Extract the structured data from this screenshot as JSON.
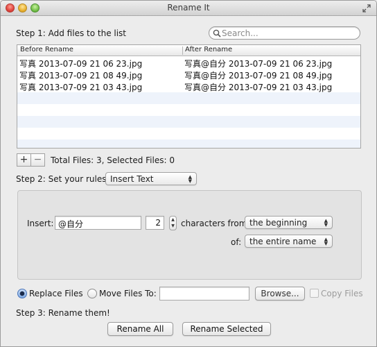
{
  "window": {
    "title": "Rename It"
  },
  "step1": {
    "label": "Step 1: Add files to the list"
  },
  "search": {
    "placeholder": "Search..."
  },
  "table": {
    "columns": [
      "Before Rename",
      "After Rename"
    ],
    "rows": [
      {
        "before": "写真 2013-07-09 21 06 23.jpg",
        "after": "写真@自分 2013-07-09 21 06 23.jpg"
      },
      {
        "before": "写真 2013-07-09 21 08 49.jpg",
        "after": "写真@自分 2013-07-09 21 08 49.jpg"
      },
      {
        "before": "写真 2013-07-09 21 03 43.jpg",
        "after": "写真@自分 2013-07-09 21 03 43.jpg"
      }
    ]
  },
  "list_controls": {
    "add_label": "+",
    "remove_label": "−",
    "status": "Total Files: 3,  Selected Files: 0"
  },
  "step2": {
    "label": "Step 2: Set your rules:",
    "rule_type": "Insert Text"
  },
  "rule": {
    "insert_label": "Insert:",
    "insert_value": "@自分",
    "count_value": "2",
    "characters_from_label": "characters from",
    "position_value": "the beginning",
    "of_label": "of:",
    "scope_value": "the entire name"
  },
  "output": {
    "replace_label": "Replace Files",
    "replace_selected": true,
    "move_label": "Move Files To:",
    "move_path": "",
    "browse_label": "Browse...",
    "copy_label": "Copy Files"
  },
  "step3": {
    "label": "Step 3: Rename them!"
  },
  "actions": {
    "rename_all": "Rename All",
    "rename_selected": "Rename Selected"
  },
  "colors": {
    "row_alt": "#eef3fb",
    "radio_accent": "#7fa9e2"
  }
}
